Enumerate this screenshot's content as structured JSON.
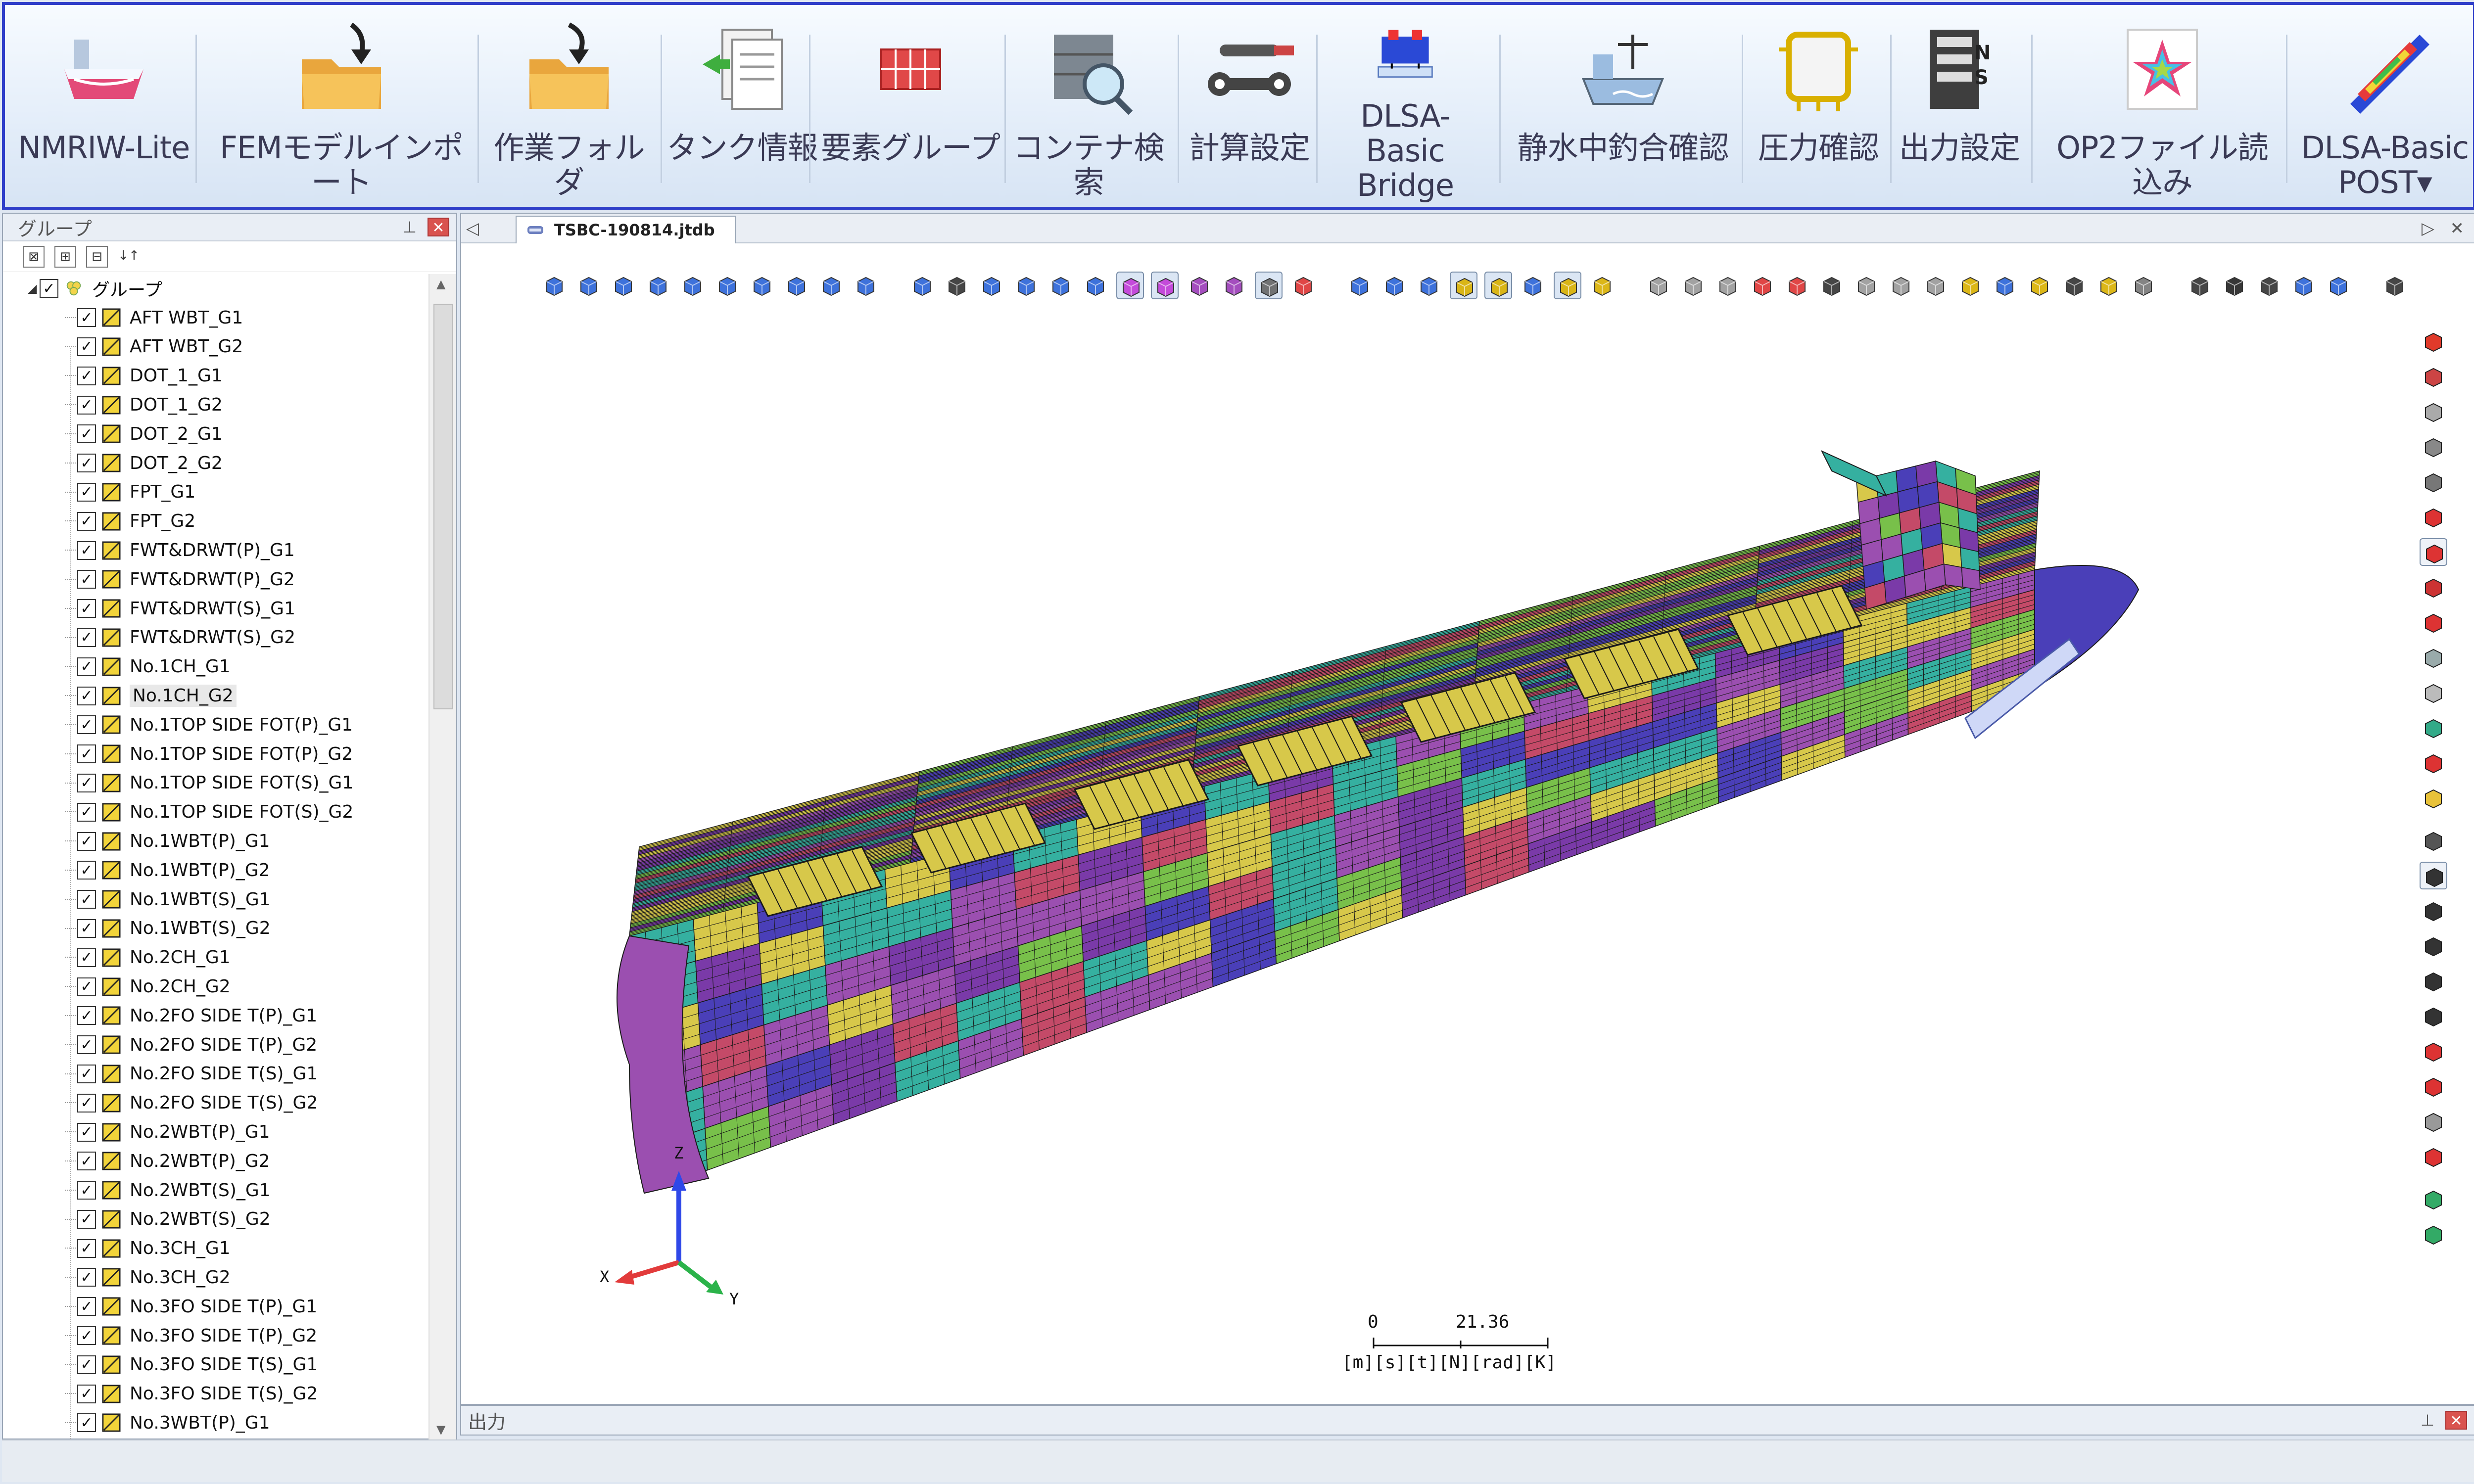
{
  "ribbon": {
    "buttons": [
      {
        "label": "NMRIW-Lite",
        "icon": "ship-hull-icon"
      },
      {
        "label": "FEMモデルインポート",
        "icon": "folder-import-icon"
      },
      {
        "label": "作業フォルダ",
        "icon": "folder-arrow-icon"
      },
      {
        "label": "タンク情報",
        "icon": "documents-arrow-icon"
      },
      {
        "label": "要素グループ",
        "icon": "element-group-icon"
      },
      {
        "label": "コンテナ検索",
        "icon": "container-search-icon"
      },
      {
        "label": "計算設定",
        "icon": "wrench-screwdriver-icon"
      },
      {
        "label": "DLSA-Basic\nBridge",
        "icon": "bridge-icon"
      },
      {
        "label": "静水中釣合確認",
        "icon": "ship-balance-icon"
      },
      {
        "label": "圧力確認",
        "icon": "pressure-icon"
      },
      {
        "label": "出力設定",
        "icon": "output-settings-icon"
      },
      {
        "label": "OP2ファイル読込み",
        "icon": "star-file-icon"
      },
      {
        "label": "DLSA-Basic\nPOST▾",
        "icon": "post-ship-icon"
      }
    ]
  },
  "group_panel": {
    "title": "グループ",
    "root": "グループ",
    "items": [
      "AFT WBT_G1",
      "AFT WBT_G2",
      "DOT_1_G1",
      "DOT_1_G2",
      "DOT_2_G1",
      "DOT_2_G2",
      "FPT_G1",
      "FPT_G2",
      "FWT&DRWT(P)_G1",
      "FWT&DRWT(P)_G2",
      "FWT&DRWT(S)_G1",
      "FWT&DRWT(S)_G2",
      "No.1CH_G1",
      "No.1CH_G2",
      "No.1TOP SIDE FOT(P)_G1",
      "No.1TOP SIDE FOT(P)_G2",
      "No.1TOP SIDE FOT(S)_G1",
      "No.1TOP SIDE FOT(S)_G2",
      "No.1WBT(P)_G1",
      "No.1WBT(P)_G2",
      "No.1WBT(S)_G1",
      "No.1WBT(S)_G2",
      "No.2CH_G1",
      "No.2CH_G2",
      "No.2FO SIDE T(P)_G1",
      "No.2FO SIDE T(P)_G2",
      "No.2FO SIDE T(S)_G1",
      "No.2FO SIDE T(S)_G2",
      "No.2WBT(P)_G1",
      "No.2WBT(P)_G2",
      "No.2WBT(S)_G1",
      "No.2WBT(S)_G2",
      "No.3CH_G1",
      "No.3CH_G2",
      "No.3FO SIDE T(P)_G1",
      "No.3FO SIDE T(P)_G2",
      "No.3FO SIDE T(S)_G1",
      "No.3FO SIDE T(S)_G2",
      "No.3WBT(P)_G1"
    ],
    "selected": "No.1CH_G2"
  },
  "document": {
    "tab_title": "TSBC-190814.jtdb"
  },
  "viewer": {
    "axis_labels": {
      "x": "X",
      "y": "Y",
      "z": "Z"
    },
    "scale": {
      "min": "0",
      "max": "21.36",
      "units": "[m][s][t][N][rad][K]"
    }
  },
  "output_panel": {
    "title": "出力"
  },
  "colors": {
    "accent_border": "#2f3ec9",
    "mesh_colors": [
      "#d7c84a",
      "#9b4fb0",
      "#c44a68",
      "#35b0a0",
      "#4a3fb8",
      "#78c04a",
      "#7a3aa8"
    ]
  }
}
